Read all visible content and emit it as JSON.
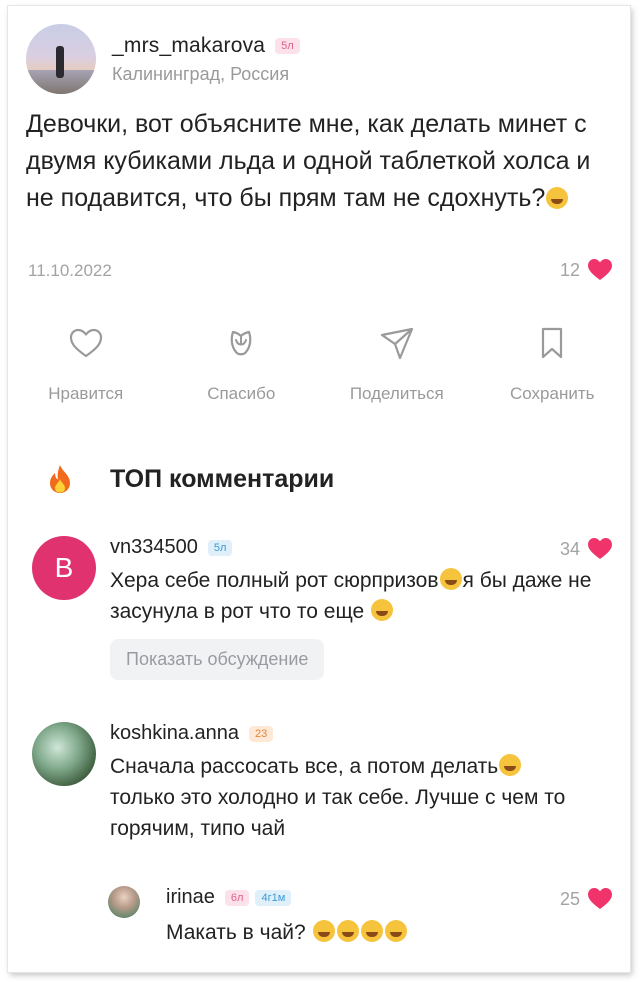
{
  "post": {
    "username": "_mrs_makarova",
    "badge": "5л",
    "location": "Калининград, Россия",
    "text": "Девочки, вот объясните мне, как делать минет с двумя кубиками льда и одной таблеткой холса и не подавится, что бы прям там не сдохнуть?",
    "date": "11.10.2022",
    "likes": "12"
  },
  "actions": [
    {
      "label": "Нравится",
      "icon": "heart-outline-icon"
    },
    {
      "label": "Спасибо",
      "icon": "tulip-icon"
    },
    {
      "label": "Поделиться",
      "icon": "send-icon"
    },
    {
      "label": "Сохранить",
      "icon": "bookmark-icon"
    }
  ],
  "top_comments_title": "ТОП комментарии",
  "comments": [
    {
      "avatar_letter": "B",
      "avatar_color": "#e0326e",
      "username": "vn334500",
      "badge": "5л",
      "likes": "34",
      "text_1": "Хера себе полный рот сюрпризов",
      "text_2": "я бы даже не засунула в рот что то еще",
      "show_discussion": "Показать обсуждение"
    },
    {
      "username": "koshkina.anna",
      "badge": "23",
      "text_1": "Сначала рассосать все, а потом делать",
      "text_2": "только это холодно и так себе. Лучше с чем то горячим, типо чай"
    }
  ],
  "reply": {
    "username": "irinae",
    "badge_1": "6л",
    "badge_2": "4г1м",
    "likes": "25",
    "text": "Макать в чай?"
  },
  "colors": {
    "heart": "#f0336b",
    "fire": "#f26a1b",
    "muted": "#9a9a9a"
  }
}
